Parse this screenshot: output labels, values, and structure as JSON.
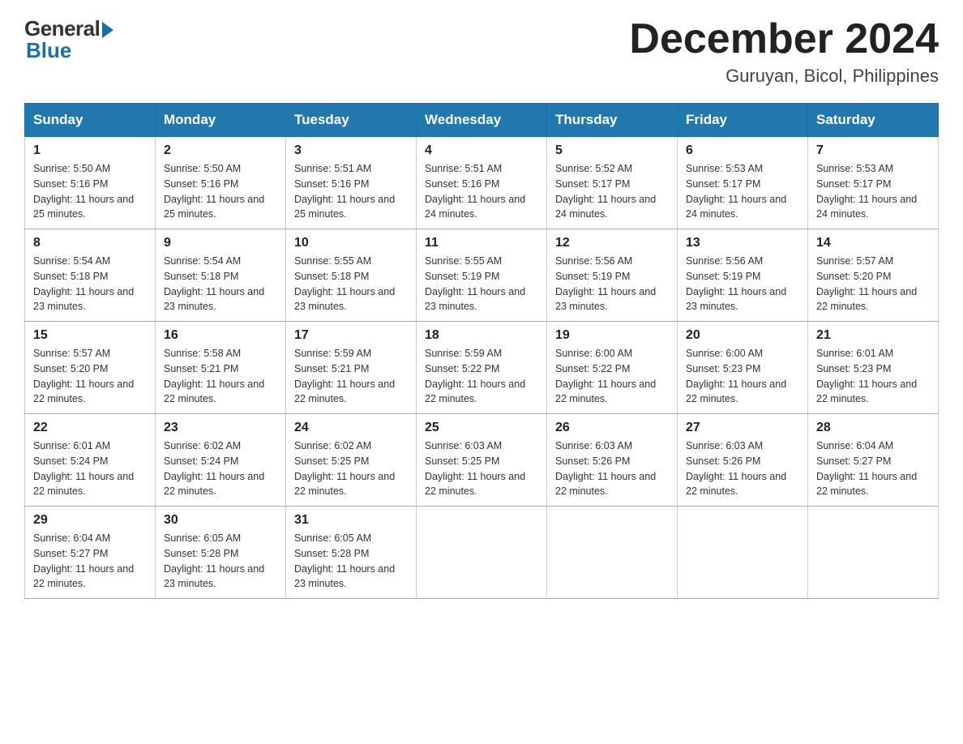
{
  "header": {
    "logo": {
      "general": "General",
      "blue": "Blue"
    },
    "title": "December 2024",
    "subtitle": "Guruyan, Bicol, Philippines"
  },
  "calendar": {
    "days_of_week": [
      "Sunday",
      "Monday",
      "Tuesday",
      "Wednesday",
      "Thursday",
      "Friday",
      "Saturday"
    ],
    "weeks": [
      [
        {
          "day": "1",
          "sunrise": "5:50 AM",
          "sunset": "5:16 PM",
          "daylight": "11 hours and 25 minutes."
        },
        {
          "day": "2",
          "sunrise": "5:50 AM",
          "sunset": "5:16 PM",
          "daylight": "11 hours and 25 minutes."
        },
        {
          "day": "3",
          "sunrise": "5:51 AM",
          "sunset": "5:16 PM",
          "daylight": "11 hours and 25 minutes."
        },
        {
          "day": "4",
          "sunrise": "5:51 AM",
          "sunset": "5:16 PM",
          "daylight": "11 hours and 24 minutes."
        },
        {
          "day": "5",
          "sunrise": "5:52 AM",
          "sunset": "5:17 PM",
          "daylight": "11 hours and 24 minutes."
        },
        {
          "day": "6",
          "sunrise": "5:53 AM",
          "sunset": "5:17 PM",
          "daylight": "11 hours and 24 minutes."
        },
        {
          "day": "7",
          "sunrise": "5:53 AM",
          "sunset": "5:17 PM",
          "daylight": "11 hours and 24 minutes."
        }
      ],
      [
        {
          "day": "8",
          "sunrise": "5:54 AM",
          "sunset": "5:18 PM",
          "daylight": "11 hours and 23 minutes."
        },
        {
          "day": "9",
          "sunrise": "5:54 AM",
          "sunset": "5:18 PM",
          "daylight": "11 hours and 23 minutes."
        },
        {
          "day": "10",
          "sunrise": "5:55 AM",
          "sunset": "5:18 PM",
          "daylight": "11 hours and 23 minutes."
        },
        {
          "day": "11",
          "sunrise": "5:55 AM",
          "sunset": "5:19 PM",
          "daylight": "11 hours and 23 minutes."
        },
        {
          "day": "12",
          "sunrise": "5:56 AM",
          "sunset": "5:19 PM",
          "daylight": "11 hours and 23 minutes."
        },
        {
          "day": "13",
          "sunrise": "5:56 AM",
          "sunset": "5:19 PM",
          "daylight": "11 hours and 23 minutes."
        },
        {
          "day": "14",
          "sunrise": "5:57 AM",
          "sunset": "5:20 PM",
          "daylight": "11 hours and 22 minutes."
        }
      ],
      [
        {
          "day": "15",
          "sunrise": "5:57 AM",
          "sunset": "5:20 PM",
          "daylight": "11 hours and 22 minutes."
        },
        {
          "day": "16",
          "sunrise": "5:58 AM",
          "sunset": "5:21 PM",
          "daylight": "11 hours and 22 minutes."
        },
        {
          "day": "17",
          "sunrise": "5:59 AM",
          "sunset": "5:21 PM",
          "daylight": "11 hours and 22 minutes."
        },
        {
          "day": "18",
          "sunrise": "5:59 AM",
          "sunset": "5:22 PM",
          "daylight": "11 hours and 22 minutes."
        },
        {
          "day": "19",
          "sunrise": "6:00 AM",
          "sunset": "5:22 PM",
          "daylight": "11 hours and 22 minutes."
        },
        {
          "day": "20",
          "sunrise": "6:00 AM",
          "sunset": "5:23 PM",
          "daylight": "11 hours and 22 minutes."
        },
        {
          "day": "21",
          "sunrise": "6:01 AM",
          "sunset": "5:23 PM",
          "daylight": "11 hours and 22 minutes."
        }
      ],
      [
        {
          "day": "22",
          "sunrise": "6:01 AM",
          "sunset": "5:24 PM",
          "daylight": "11 hours and 22 minutes."
        },
        {
          "day": "23",
          "sunrise": "6:02 AM",
          "sunset": "5:24 PM",
          "daylight": "11 hours and 22 minutes."
        },
        {
          "day": "24",
          "sunrise": "6:02 AM",
          "sunset": "5:25 PM",
          "daylight": "11 hours and 22 minutes."
        },
        {
          "day": "25",
          "sunrise": "6:03 AM",
          "sunset": "5:25 PM",
          "daylight": "11 hours and 22 minutes."
        },
        {
          "day": "26",
          "sunrise": "6:03 AM",
          "sunset": "5:26 PM",
          "daylight": "11 hours and 22 minutes."
        },
        {
          "day": "27",
          "sunrise": "6:03 AM",
          "sunset": "5:26 PM",
          "daylight": "11 hours and 22 minutes."
        },
        {
          "day": "28",
          "sunrise": "6:04 AM",
          "sunset": "5:27 PM",
          "daylight": "11 hours and 22 minutes."
        }
      ],
      [
        {
          "day": "29",
          "sunrise": "6:04 AM",
          "sunset": "5:27 PM",
          "daylight": "11 hours and 22 minutes."
        },
        {
          "day": "30",
          "sunrise": "6:05 AM",
          "sunset": "5:28 PM",
          "daylight": "11 hours and 23 minutes."
        },
        {
          "day": "31",
          "sunrise": "6:05 AM",
          "sunset": "5:28 PM",
          "daylight": "11 hours and 23 minutes."
        },
        null,
        null,
        null,
        null
      ]
    ]
  }
}
